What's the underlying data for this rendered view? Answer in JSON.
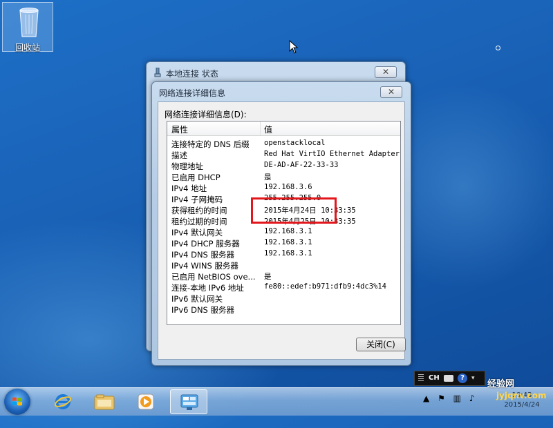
{
  "desktop": {
    "recycle_bin_label": "回收站"
  },
  "back_window": {
    "title": "本地连接 状态",
    "close_glyph": "✕"
  },
  "dialog": {
    "title": "网络连接详细信息",
    "close_glyph": "✕",
    "list_label": "网络连接详细信息(D):",
    "columns": {
      "property": "属性",
      "value": "值"
    },
    "rows": [
      {
        "property": "连接特定的 DNS 后缀",
        "value": "openstacklocal"
      },
      {
        "property": "描述",
        "value": "Red Hat VirtIO Ethernet Adapter"
      },
      {
        "property": "物理地址",
        "value": "DE-AD-AF-22-33-33"
      },
      {
        "property": "已启用 DHCP",
        "value": "是"
      },
      {
        "property": "IPv4 地址",
        "value": "192.168.3.6"
      },
      {
        "property": "IPv4 子网掩码",
        "value": "255.255.255.0"
      },
      {
        "property": "获得租约的时间",
        "value": "2015年4月24日 10:33:35"
      },
      {
        "property": "租约过期的时间",
        "value": "2015年4月25日 10:33:35"
      },
      {
        "property": "IPv4 默认网关",
        "value": "192.168.3.1"
      },
      {
        "property": "IPv4 DHCP 服务器",
        "value": "192.168.3.1"
      },
      {
        "property": "IPv4 DNS 服务器",
        "value": "192.168.3.1"
      },
      {
        "property": "IPv4 WINS 服务器",
        "value": ""
      },
      {
        "property": "已启用 NetBIOS ove...",
        "value": "是"
      },
      {
        "property": "连接-本地 IPv6 地址",
        "value": "fe80::edef:b971:dfb9:4dc3%14"
      },
      {
        "property": "IPv6 默认网关",
        "value": ""
      },
      {
        "property": "IPv6 DNS 服务器",
        "value": ""
      }
    ],
    "close_button_label": "关闭(C)",
    "highlight_color": "#e3161c"
  },
  "language_bar": {
    "language": "CH",
    "help_glyph": "?"
  },
  "taskbar": {
    "tray_icons": [
      "flag-icon",
      "network-icon",
      "volume-icon"
    ],
    "clock_time": "10:43",
    "clock_date": "2015/4/24"
  },
  "watermark": {
    "line1": "经验网",
    "line2": "jyjqnv.com"
  }
}
